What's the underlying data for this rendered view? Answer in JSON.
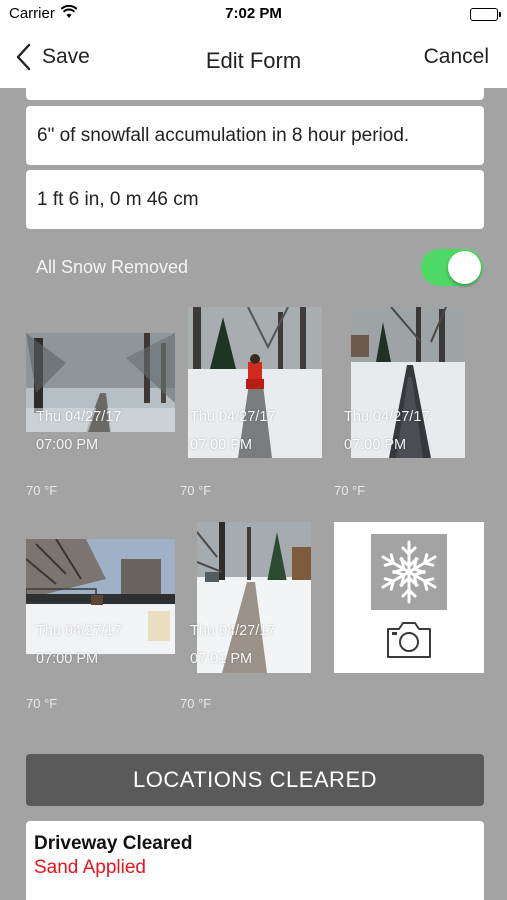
{
  "status_bar": {
    "carrier": "Carrier",
    "time": "7:02 PM"
  },
  "nav": {
    "back_label": "Save",
    "title": "Edit Form",
    "cancel_label": "Cancel"
  },
  "fields": [
    {
      "value": "6\" of snowfall accumulation in 8 hour period."
    },
    {
      "value": "1 ft 6 in, 0 m 46 cm"
    }
  ],
  "snow_removed": {
    "label": "All Snow Removed",
    "on": true,
    "on_color": "#4cd964"
  },
  "photos": [
    {
      "date": "Thu 04/27/17",
      "time": "07:00 PM",
      "temp": "70 °F",
      "icon": "snowy-road-photo"
    },
    {
      "date": "Thu 04/27/17",
      "time": "07:00 PM",
      "temp": "70 °F",
      "icon": "snowblower-photo"
    },
    {
      "date": "Thu 04/27/17",
      "time": "07:00 PM",
      "temp": "70 °F",
      "icon": "sidewalk-photo"
    },
    {
      "date": "Thu 04/27/17",
      "time": "07:00 PM",
      "temp": "70 °F",
      "icon": "snowy-yard-photo"
    },
    {
      "date": "Thu 04/27/17",
      "time": "07:01 PM",
      "temp": "70 °F",
      "icon": "cleared-path-photo"
    }
  ],
  "add_photo": {
    "icons": [
      "snowflake-icon",
      "camera-icon"
    ]
  },
  "locations": {
    "header": "LOCATIONS CLEARED",
    "items": [
      {
        "title": "Driveway Cleared",
        "subtitle": "Sand Applied",
        "subtitle_color": "#e8141b"
      }
    ]
  }
}
